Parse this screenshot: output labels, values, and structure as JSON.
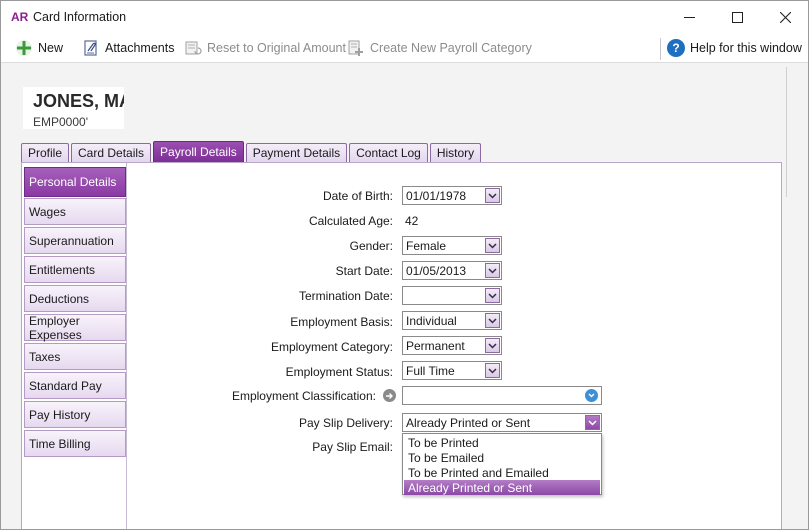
{
  "window": {
    "logo": "AR",
    "title": "Card Information"
  },
  "toolbar": {
    "new_label": "New",
    "attachments_label": "Attachments",
    "reset_label": "Reset to Original Amount",
    "create_category_label": "Create New Payroll Category",
    "help_label": "Help for this window"
  },
  "employee": {
    "name": "JONES, MA",
    "id": "EMP0000'"
  },
  "tabs": [
    {
      "label": "Profile",
      "active": false
    },
    {
      "label": "Card Details",
      "active": false
    },
    {
      "label": "Payroll Details",
      "active": true
    },
    {
      "label": "Payment Details",
      "active": false
    },
    {
      "label": "Contact Log",
      "active": false
    },
    {
      "label": "History",
      "active": false
    }
  ],
  "sidenav": [
    {
      "label": "Personal Details",
      "active": true
    },
    {
      "label": "Wages",
      "active": false
    },
    {
      "label": "Superannuation",
      "active": false
    },
    {
      "label": "Entitlements",
      "active": false
    },
    {
      "label": "Deductions",
      "active": false
    },
    {
      "label": "Employer Expenses",
      "active": false
    },
    {
      "label": "Taxes",
      "active": false
    },
    {
      "label": "Standard Pay",
      "active": false
    },
    {
      "label": "Pay History",
      "active": false
    },
    {
      "label": "Time Billing",
      "active": false
    }
  ],
  "form": {
    "dob_label": "Date of Birth:",
    "dob_value": "01/01/1978",
    "age_label": "Calculated Age:",
    "age_value": "42",
    "gender_label": "Gender:",
    "gender_value": "Female",
    "start_label": "Start Date:",
    "start_value": "01/05/2013",
    "termination_label": "Termination Date:",
    "termination_value": "",
    "basis_label": "Employment Basis:",
    "basis_value": "Individual",
    "category_label": "Employment Category:",
    "category_value": "Permanent",
    "status_label": "Employment Status:",
    "status_value": "Full Time",
    "classification_label": "Employment Classification:",
    "classification_value": "",
    "delivery_label": "Pay Slip Delivery:",
    "delivery_value": "Already Printed or Sent",
    "email_label": "Pay Slip Email:"
  },
  "delivery_options": [
    {
      "label": "To be Printed",
      "selected": false
    },
    {
      "label": "To be Emailed",
      "selected": false
    },
    {
      "label": "To be Printed and Emailed",
      "selected": false
    },
    {
      "label": "Already Printed or Sent",
      "selected": true
    }
  ],
  "colors": {
    "accent": "#8a3aa3",
    "logo": "#8a1f8f",
    "help": "#1f6fc0"
  }
}
